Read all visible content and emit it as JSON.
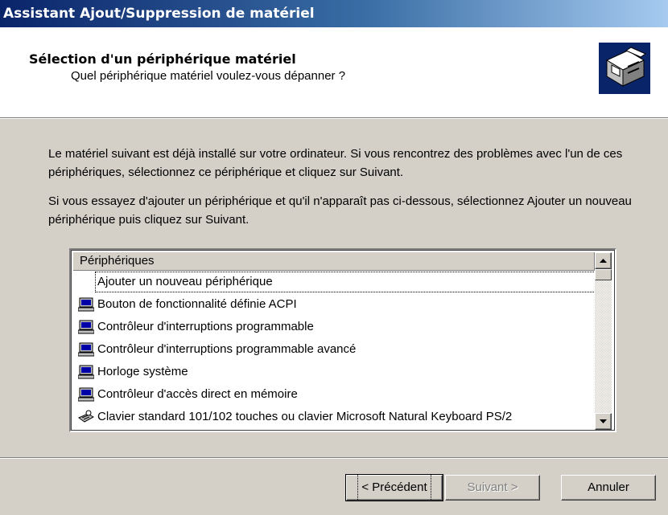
{
  "window": {
    "title": "Assistant Ajout/Suppression de matériel"
  },
  "header": {
    "title": "Sélection d'un périphérique matériel",
    "subtitle": "Quel périphérique matériel voulez-vous dépanner ?",
    "icon": "hardware-wizard-icon"
  },
  "intro": {
    "paragraph1": "Le matériel suivant est déjà installé sur votre ordinateur. Si vous rencontrez des problèmes avec l'un de ces périphériques, sélectionnez ce périphérique et cliquez sur Suivant.",
    "paragraph2": "Si vous essayez d'ajouter un périphérique et qu'il n'apparaît pas ci-dessous, sélectionnez Ajouter un nouveau périphérique puis cliquez sur Suivant."
  },
  "devices": {
    "column_header": "Périphériques",
    "items": [
      {
        "label": "Ajouter un nouveau périphérique",
        "icon": "none",
        "selected": true
      },
      {
        "label": "Bouton de fonctionnalité définie ACPI",
        "icon": "computer-icon"
      },
      {
        "label": "Contrôleur d'interruptions programmable",
        "icon": "computer-icon"
      },
      {
        "label": "Contrôleur d'interruptions programmable avancé",
        "icon": "computer-icon"
      },
      {
        "label": "Horloge système",
        "icon": "computer-icon"
      },
      {
        "label": "Contrôleur d'accès direct en mémoire",
        "icon": "computer-icon"
      },
      {
        "label": "Clavier standard 101/102 touches ou clavier Microsoft Natural Keyboard PS/2",
        "icon": "keyboard-icon"
      }
    ]
  },
  "buttons": {
    "back": "< Précédent",
    "next": "Suivant >",
    "cancel": "Annuler"
  },
  "colors": {
    "titlebar_start": "#0a246a",
    "titlebar_end": "#a6caf0",
    "dialog_bg": "#d4d0c8"
  }
}
